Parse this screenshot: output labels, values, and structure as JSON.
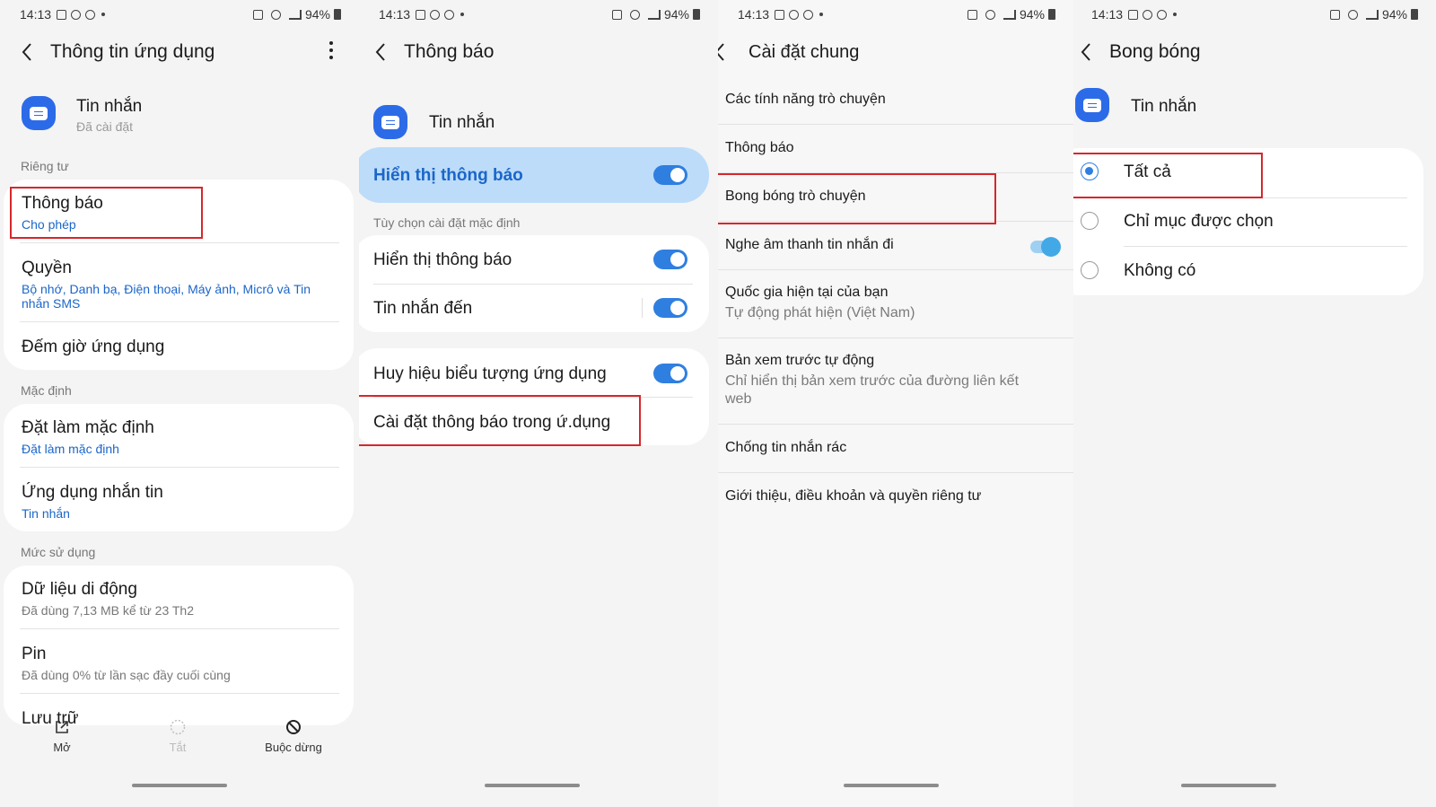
{
  "status_bar": {
    "time": "14:13",
    "battery": "94%"
  },
  "colors": {
    "accent": "#2f7fe0",
    "highlight": "#bcdcfa",
    "annotation_box": "#d4282c"
  },
  "panel1": {
    "title": "Thông tin ứng dụng",
    "app_name": "Tin nhắn",
    "app_status": "Đã cài đặt",
    "section_privacy": "Riêng tư",
    "notifications": {
      "title": "Thông báo",
      "sub": "Cho phép"
    },
    "permissions": {
      "title": "Quyền",
      "sub": "Bộ nhớ, Danh bạ, Điện thoại, Máy ảnh, Micrô và Tin nhắn SMS"
    },
    "app_timer": {
      "title": "Đếm giờ ứng dụng"
    },
    "section_default": "Mặc định",
    "set_default": {
      "title": "Đặt làm mặc định",
      "sub": "Đặt làm mặc định"
    },
    "messaging_app": {
      "title": "Ứng dụng nhắn tin",
      "sub": "Tin nhắn"
    },
    "section_usage": "Mức sử dụng",
    "mobile_data": {
      "title": "Dữ liệu di động",
      "sub": "Đã dùng 7,13 MB kể từ 23 Th2"
    },
    "battery": {
      "title": "Pin",
      "sub": "Đã dùng 0% từ lần sạc đầy cuối cùng"
    },
    "storage": {
      "title": "Lưu trữ"
    },
    "nav": {
      "open": "Mở",
      "disable": "Tắt",
      "force_stop": "Buộc dừng"
    }
  },
  "panel2": {
    "title": "Thông báo",
    "app_name": "Tin nhắn",
    "show_notifications_master": "Hiển thị thông báo",
    "section_default_options": "Tùy chọn cài đặt mặc định",
    "show_notifications": "Hiển thị thông báo",
    "incoming_messages": "Tin nhắn đến",
    "app_icon_badges": "Huy hiệu biểu tượng ứng dụng",
    "in_app_notification_settings": "Cài đặt thông báo trong ứ.dụng"
  },
  "panel3": {
    "title": "Cài đặt chung",
    "items": {
      "chat_features": "Các tính năng trò chuyện",
      "notifications": "Thông báo",
      "chat_bubbles": "Bong bóng trò chuyện",
      "outgoing_sound": "Nghe âm thanh tin nhắn đi",
      "current_country": {
        "title": "Quốc gia hiện tại của bạn",
        "sub": "Tự động phát hiện (Việt Nam)"
      },
      "auto_preview": {
        "title": "Bản xem trước tự động",
        "sub": "Chỉ hiển thị bản xem trước của đường liên kết web"
      },
      "spam_protection": "Chống tin nhắn rác",
      "about": "Giới thiệu, điều khoản và quyền riêng tư"
    }
  },
  "panel4": {
    "title": "Bong bóng",
    "app_name": "Tin nhắn",
    "options": {
      "all": "Tất cả",
      "selected": "Chỉ mục được chọn",
      "none": "Không có"
    },
    "selected_option": "all"
  }
}
